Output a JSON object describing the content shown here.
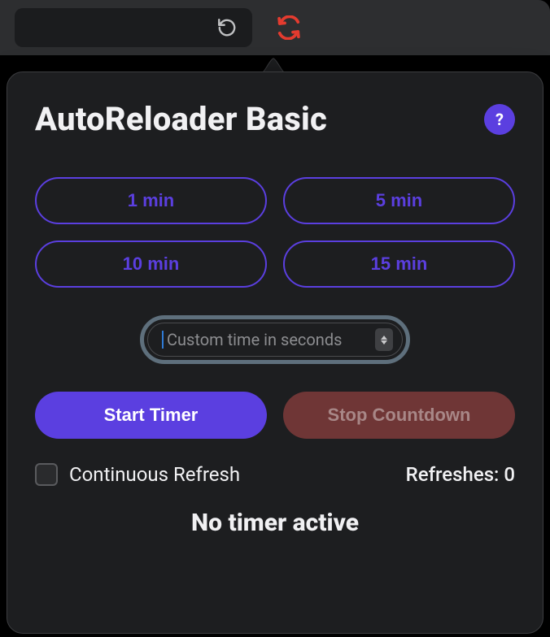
{
  "header": {
    "title": "AutoReloader Basic",
    "help_label": "?"
  },
  "presets": [
    {
      "label": "1 min"
    },
    {
      "label": "5 min"
    },
    {
      "label": "10 min"
    },
    {
      "label": "15 min"
    }
  ],
  "custom": {
    "placeholder": "Custom time in seconds",
    "value": ""
  },
  "actions": {
    "start_label": "Start Timer",
    "stop_label": "Stop Countdown"
  },
  "continuous": {
    "label": "Continuous Refresh",
    "checked": false
  },
  "refreshes": {
    "label_prefix": "Refreshes: ",
    "count": "0"
  },
  "footer": {
    "status": "No timer active"
  },
  "colors": {
    "accent": "#5b3fe0",
    "stop_bg": "#6f3636"
  }
}
